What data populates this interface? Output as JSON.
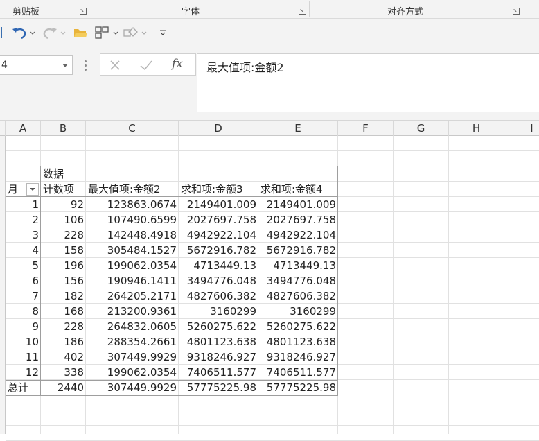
{
  "ribbon": {
    "groups": [
      {
        "label": "剪贴板"
      },
      {
        "label": "字体"
      },
      {
        "label": "对齐方式"
      }
    ]
  },
  "formula_bar": {
    "name_box": "4",
    "formula": "最大值项:金额2",
    "fx_label": "fx"
  },
  "columns": [
    "A",
    "B",
    "C",
    "D",
    "E",
    "F",
    "G",
    "H",
    "I"
  ],
  "pivot": {
    "data_label": "数据",
    "row_field": "月",
    "headers": [
      "计数项",
      "最大值项:金额2",
      "求和项:金额3",
      "求和项:金额4"
    ],
    "rows": [
      [
        "1",
        "92",
        "123863.0674",
        "2149401.009",
        "2149401.009"
      ],
      [
        "2",
        "106",
        "107490.6599",
        "2027697.758",
        "2027697.758"
      ],
      [
        "3",
        "228",
        "142448.4918",
        "4942922.104",
        "4942922.104"
      ],
      [
        "4",
        "158",
        "305484.1527",
        "5672916.782",
        "5672916.782"
      ],
      [
        "5",
        "196",
        "199062.0354",
        "4713449.13",
        "4713449.13"
      ],
      [
        "6",
        "156",
        "190946.1411",
        "3494776.048",
        "3494776.048"
      ],
      [
        "7",
        "182",
        "264205.2171",
        "4827606.382",
        "4827606.382"
      ],
      [
        "8",
        "168",
        "213200.9361",
        "3160299",
        "3160299"
      ],
      [
        "9",
        "228",
        "264832.0605",
        "5260275.622",
        "5260275.622"
      ],
      [
        "10",
        "186",
        "288354.2661",
        "4801123.638",
        "4801123.638"
      ],
      [
        "11",
        "402",
        "307449.9929",
        "9318246.927",
        "9318246.927"
      ],
      [
        "12",
        "338",
        "199062.0354",
        "7406511.577",
        "7406511.577"
      ]
    ],
    "total": [
      "总计",
      "2440",
      "307449.9929",
      "57775225.98",
      "57775225.98"
    ]
  }
}
